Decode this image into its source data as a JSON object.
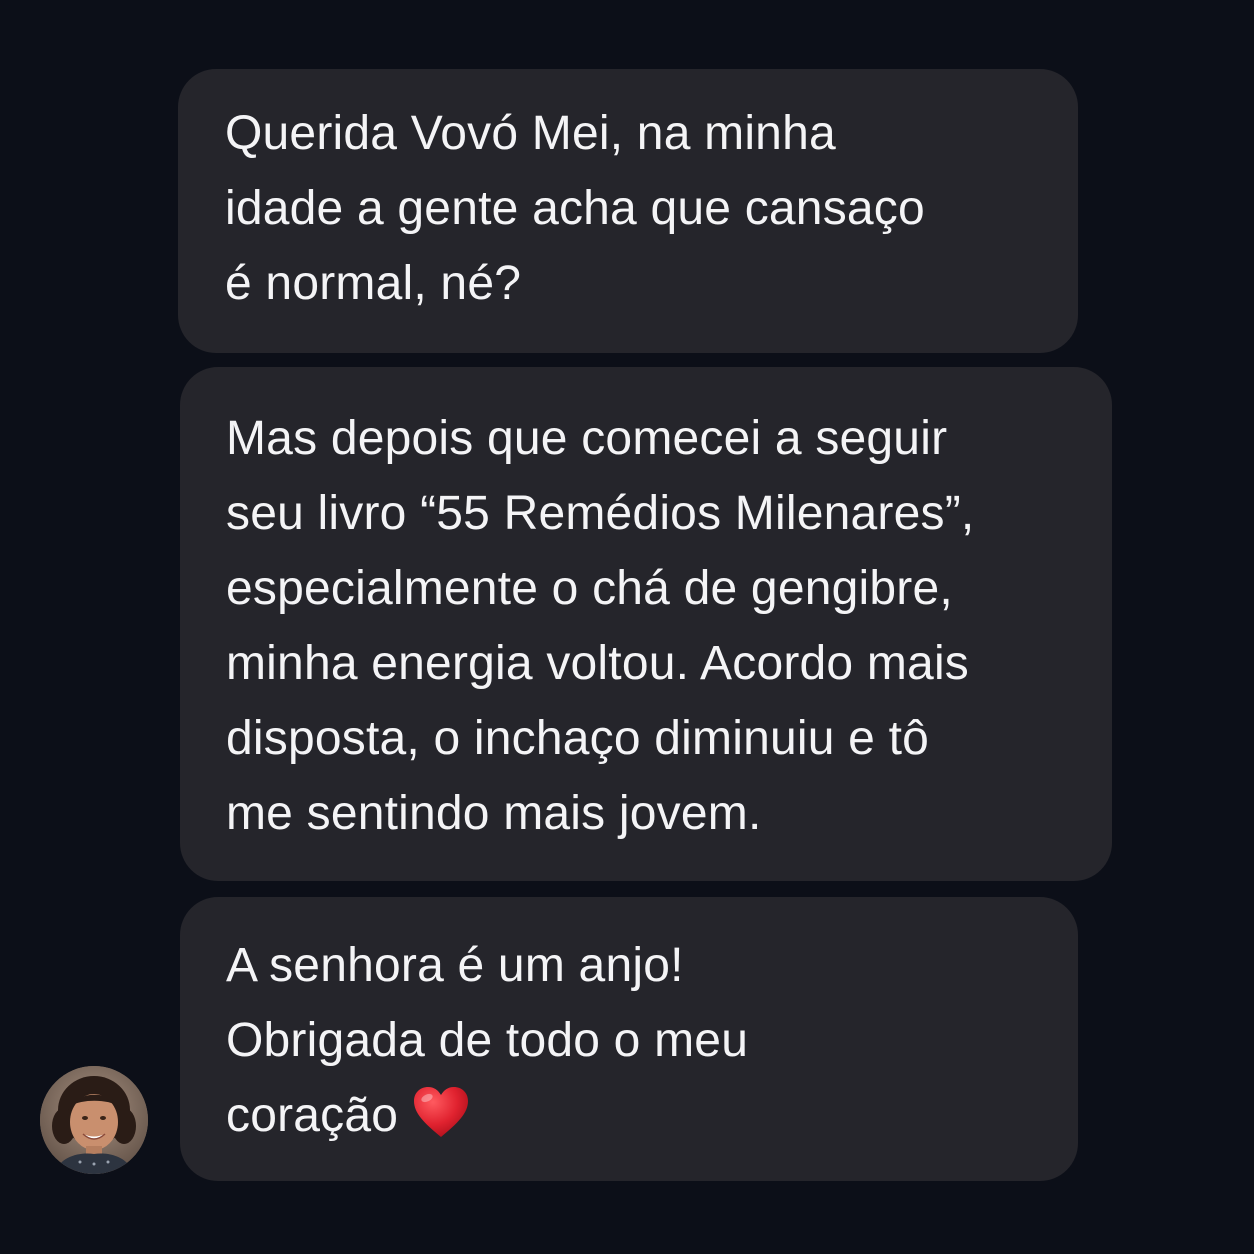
{
  "conversation": {
    "messages": [
      {
        "lines": [
          "Querida Vovó Mei, na minha",
          "idade a gente acha que cansaço",
          "é normal, né?"
        ]
      },
      {
        "lines": [
          "Mas depois que comecei a seguir",
          "seu livro “55 Remédios Milenares”,",
          "especialmente o chá de gengibre,",
          "minha energia voltou. Acordo mais",
          "disposta, o inchaço diminuiu e tô",
          "me sentindo mais jovem."
        ]
      },
      {
        "lines": [
          "A senhora é um anjo!",
          "Obrigada de todo o meu",
          "coração"
        ],
        "trailing_icon": "red-heart-icon"
      }
    ]
  },
  "avatar": {
    "icon": "user-avatar-photo"
  },
  "colors": {
    "background": "#0c0f18",
    "bubble": "#25252b",
    "text": "#f4f4f6",
    "heart": "#e0222f"
  }
}
